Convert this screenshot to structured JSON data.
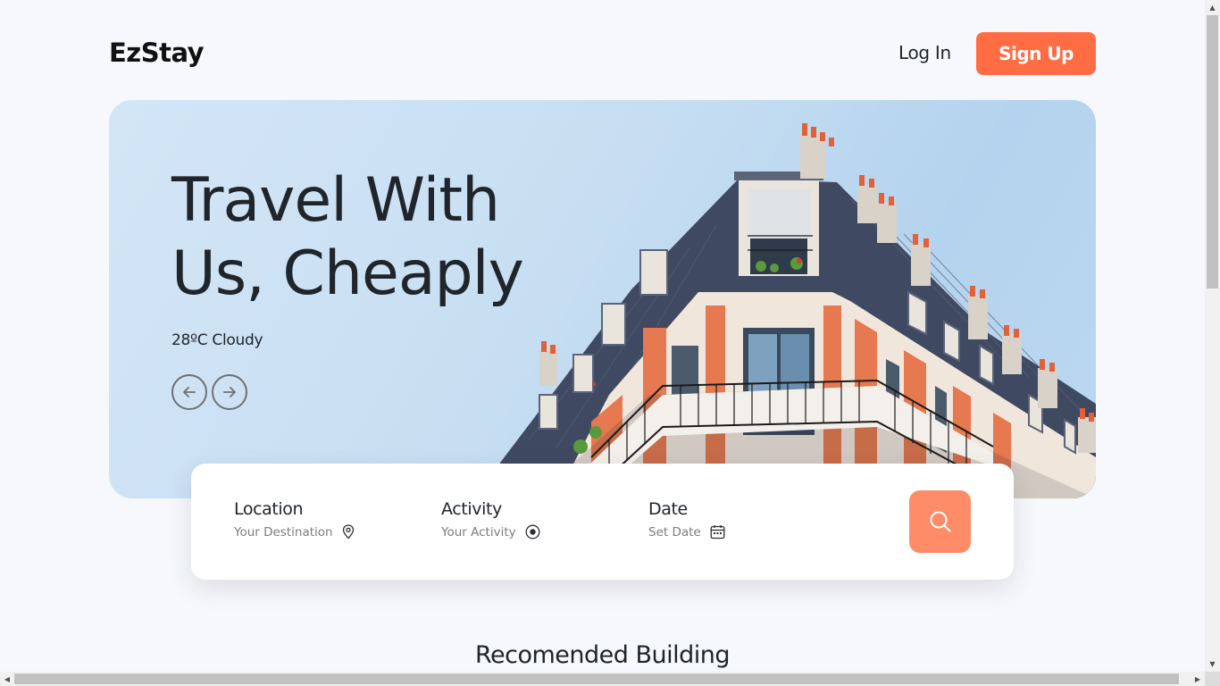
{
  "header": {
    "logo": "EzStay",
    "login_label": "Log In",
    "signup_label": "Sign Up"
  },
  "hero": {
    "title": "Travel With Us, Cheaply",
    "weather": "28ºC Cloudy",
    "prev_icon": "arrow-left-icon",
    "next_icon": "arrow-right-icon"
  },
  "search": {
    "location_label": "Location",
    "location_value": "Your Destination",
    "location_icon": "map-pin-icon",
    "activity_label": "Activity",
    "activity_value": "Your Activity",
    "activity_icon": "target-icon",
    "date_label": "Date",
    "date_value": "Set Date",
    "date_icon": "calendar-icon",
    "button_icon": "search-icon"
  },
  "section": {
    "title": "Recomended Building"
  },
  "colors": {
    "accent": "#ff6d45",
    "search_button": "#ff8c68",
    "background": "#f6f8fb"
  }
}
